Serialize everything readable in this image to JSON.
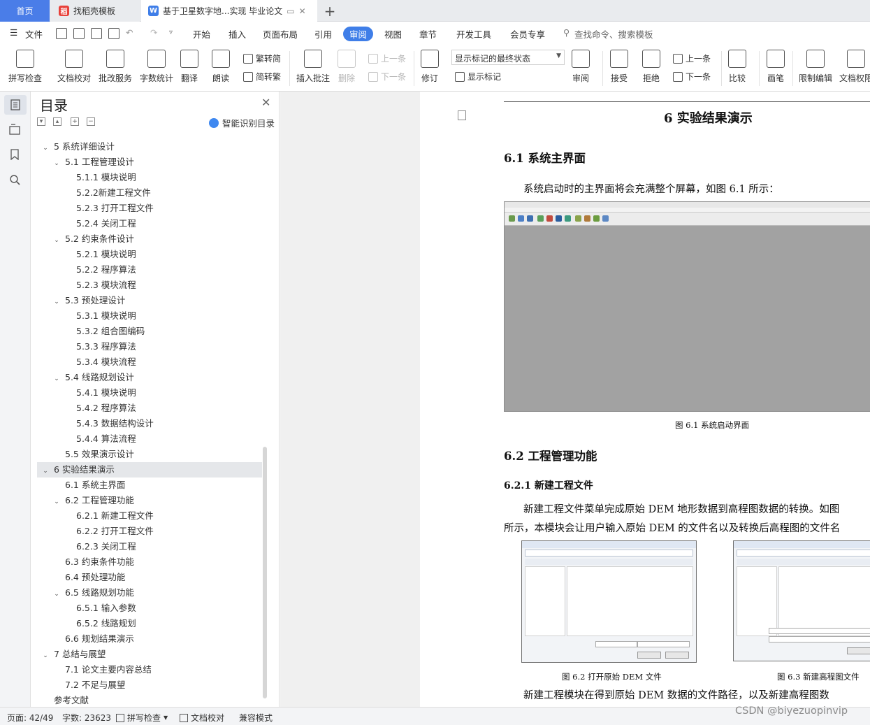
{
  "tabs": {
    "home": "首页",
    "docer": "找稻壳模板",
    "doc": "基于卫星数字地...实现 毕业论文",
    "add": "+"
  },
  "menu": {
    "file": "文件",
    "items": [
      "开始",
      "插入",
      "页面布局",
      "引用",
      "审阅",
      "视图",
      "章节",
      "开发工具",
      "会员专享"
    ],
    "active": "审阅",
    "search": "查找命令、搜索模板"
  },
  "ribbon": {
    "spellcheck": "拼写检查",
    "doc_check": "文档校对",
    "batch_service": "批改服务",
    "word_count": "字数统计",
    "translate": "翻译",
    "read_aloud": "朗读",
    "to_traditional": "繁转简",
    "to_simplified": "简转繁",
    "insert_comment": "插入批注",
    "delete": "删除",
    "prev_comment": "上一条",
    "next_comment": "下一条",
    "revise": "修订",
    "markup_state": "显示标记的最终状态",
    "show_markup": "显示标记",
    "review": "审阅",
    "accept": "接受",
    "reject": "拒绝",
    "prev_change": "上一条",
    "next_change": "下一条",
    "compare": "比较",
    "pen": "画笔",
    "restrict_edit": "限制编辑",
    "doc_permission": "文档权限"
  },
  "nav": {
    "title": "目录",
    "smart": "智能识别目录",
    "items": [
      {
        "level": 0,
        "text": "5  系统详细设计",
        "expand": true
      },
      {
        "level": 1,
        "text": "5.1  工程管理设计",
        "expand": true
      },
      {
        "level": 2,
        "text": "5.1.1  模块说明"
      },
      {
        "level": 2,
        "text": "5.2.2新建工程文件"
      },
      {
        "level": 2,
        "text": "5.2.3  打开工程文件"
      },
      {
        "level": 2,
        "text": "5.2.4  关闭工程"
      },
      {
        "level": 1,
        "text": "5.2  约束条件设计",
        "expand": true
      },
      {
        "level": 2,
        "text": "5.2.1  模块说明"
      },
      {
        "level": 2,
        "text": "5.2.2  程序算法"
      },
      {
        "level": 2,
        "text": "5.2.3  模块流程"
      },
      {
        "level": 1,
        "text": "5.3  预处理设计",
        "expand": true
      },
      {
        "level": 2,
        "text": "5.3.1  模块说明"
      },
      {
        "level": 2,
        "text": "5.3.2  组合图编码"
      },
      {
        "level": 2,
        "text": "5.3.3  程序算法"
      },
      {
        "level": 2,
        "text": "5.3.4  模块流程"
      },
      {
        "level": 1,
        "text": "5.4  线路规划设计",
        "expand": true
      },
      {
        "level": 2,
        "text": "5.4.1  模块说明"
      },
      {
        "level": 2,
        "text": "5.4.2  程序算法"
      },
      {
        "level": 2,
        "text": "5.4.3  数据结构设计"
      },
      {
        "level": 2,
        "text": "5.4.4  算法流程"
      },
      {
        "level": 1,
        "text": "5.5  效果演示设计"
      },
      {
        "level": 0,
        "text": "6  实验结果演示",
        "expand": true,
        "selected": true
      },
      {
        "level": 1,
        "text": "6.1  系统主界面"
      },
      {
        "level": 1,
        "text": "6.2  工程管理功能",
        "expand": true
      },
      {
        "level": 2,
        "text": "6.2.1  新建工程文件"
      },
      {
        "level": 2,
        "text": "6.2.2  打开工程文件"
      },
      {
        "level": 2,
        "text": "6.2.3  关闭工程"
      },
      {
        "level": 1,
        "text": "6.3  约束条件功能"
      },
      {
        "level": 1,
        "text": "6.4  预处理功能"
      },
      {
        "level": 1,
        "text": "6.5  线路规划功能",
        "expand": true
      },
      {
        "level": 2,
        "text": "6.5.1  输入参数"
      },
      {
        "level": 2,
        "text": "6.5.2  线路规划"
      },
      {
        "level": 1,
        "text": "6.6  规划结果演示"
      },
      {
        "level": 0,
        "text": "7  总结与展望",
        "expand": true
      },
      {
        "level": 1,
        "text": "7.1  论文主要内容总结"
      },
      {
        "level": 1,
        "text": "7.2  不足与展望"
      },
      {
        "level": 0,
        "text": "参考文献"
      }
    ]
  },
  "doc": {
    "chapter_title": "6  实验结果演示",
    "sec_6_1": "6.1  系统主界面",
    "para_1": "系统启动时的主界面将会充满整个屏幕，如图 6.1 所示：",
    "fig1_caption": "图 6.1  系统启动界面",
    "sec_6_2": "6.2  工程管理功能",
    "sec_6_2_1": "6.2.1  新建工程文件",
    "para_2a": "新建工程文件菜单完成原始 DEM 地形数据到高程图数据的转换。如图",
    "para_2b": "所示，本模块会让用户输入原始 DEM 的文件名以及转换后高程图的文件名",
    "fig2_caption": "图 6.2  打开原始 DEM 文件",
    "fig3_caption": "图 6.3  新建高程图文件",
    "para_3": "新建工程模块在得到原始 DEM 数据的文件路径，以及新建高程图数"
  },
  "status": {
    "page": "页面: 42/49",
    "words": "字数: 23623",
    "spell": "拼写检查",
    "proof": "文档校对",
    "compat": "兼容模式"
  },
  "watermark": "CSDN @biyezuopinvip",
  "colors": {
    "accent": "#3f7ee8",
    "home_tab": "#4a7de8"
  }
}
